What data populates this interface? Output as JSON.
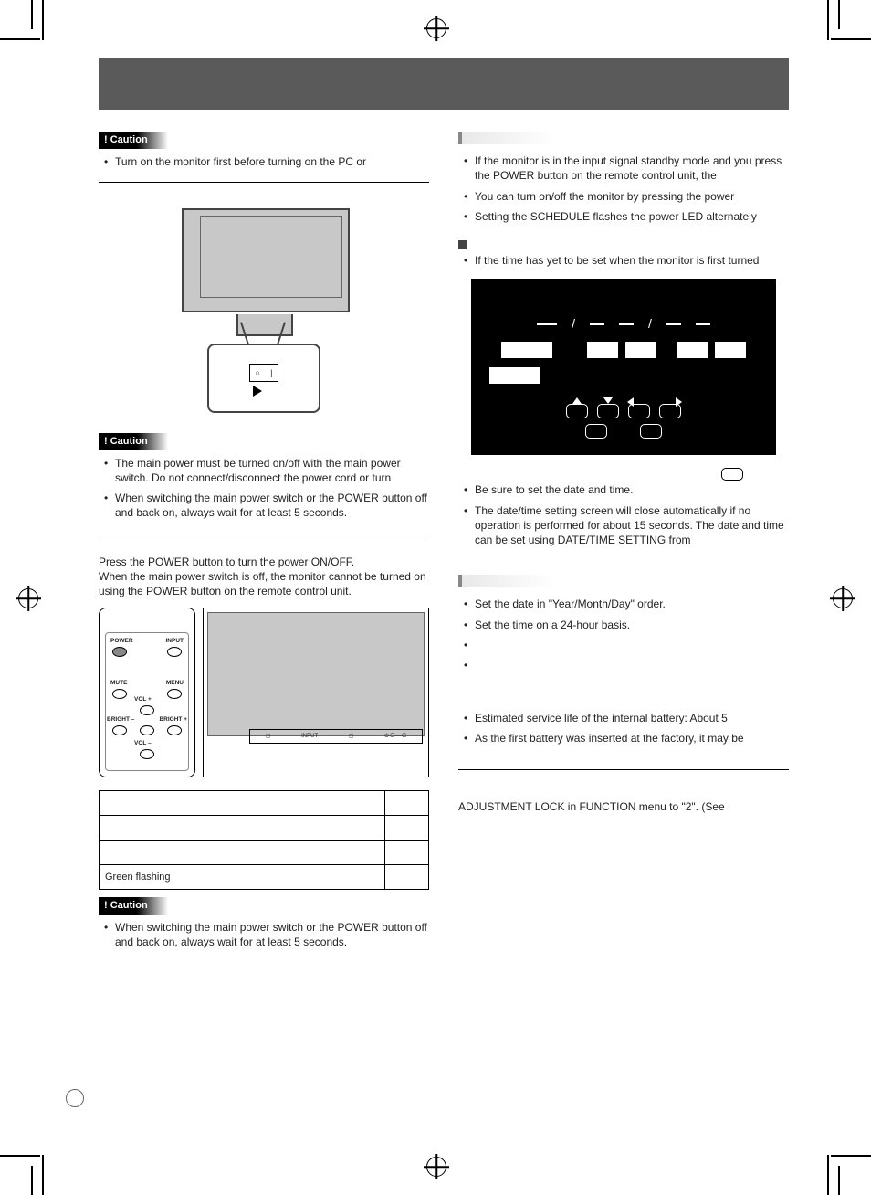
{
  "caution_label": "Caution",
  "left": {
    "c1_b1": "Turn on the monitor first before turning on the PC or",
    "c2_b1": "The main power must be turned on/off with the main power switch. Do not connect/disconnect the power cord or turn",
    "c2_b2": "When switching the main power switch or the POWER button off and back on, always wait for at least 5 seconds.",
    "para1": "Press the POWER button to turn the power ON/OFF.",
    "para2": "When the main power switch is off, the monitor cannot be turned on using the POWER button on the remote control unit.",
    "remote": {
      "power": "POWER",
      "input": "INPUT",
      "mute": "MUTE",
      "menu": "MENU",
      "volp": "VOL +",
      "volm": "VOL –",
      "brm": "BRIGHT –",
      "brp": "BRIGHT +"
    },
    "bar_input": "INPUT",
    "table_cell": "Green flashing",
    "c3_b1": "When switching the main power switch or the POWER button off and back on, always wait for at least 5 seconds."
  },
  "right": {
    "t1_b1": "If the monitor is in the input signal standby mode and you press the POWER button on the remote control unit, the",
    "t1_b2": "You can turn on/off the monitor by pressing the power",
    "t1_b3": "Setting the SCHEDULE flashes the power LED alternately",
    "s2_b1": "If the time has yet to be set when the monitor is first turned",
    "t2_b1": "Be sure to set the date and time.",
    "t2_b2": "The date/time setting screen will close automatically if no operation is performed for about 15 seconds. The date and time can be set using DATE/TIME SETTING from",
    "t3_b1": "Set the date in \"Year/Month/Day\" order.",
    "t3_b2": "Set the time on a 24-hour basis.",
    "t4_b1": "Estimated service life of the internal battery: About 5",
    "t4_b2": "As the first battery was inserted at the factory, it may be",
    "foot": "ADJUSTMENT LOCK in FUNCTION menu to \"2\". (See"
  }
}
